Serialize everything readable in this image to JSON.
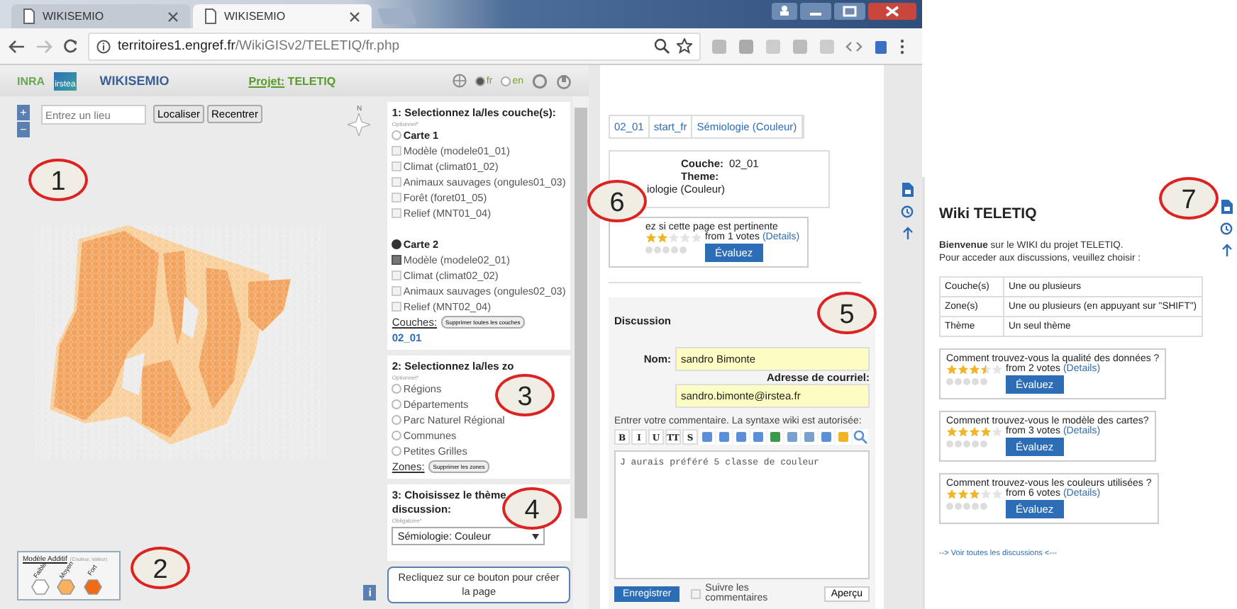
{
  "browser": {
    "tabs": [
      {
        "title": "WIKISEMIO",
        "selected": false
      },
      {
        "title": "WIKISEMIO",
        "selected": true
      }
    ],
    "url_host": "territoires1.engref.fr",
    "url_path": "/WikiGISv2/TELETIQ/fr.php"
  },
  "header": {
    "logo_inra": "INRA",
    "logo_irstea": "irstea",
    "app_name": "WIKISEMIO",
    "project_label": "Projet:",
    "project_name": "TELETIQ",
    "languages": [
      {
        "code": "fr",
        "selected": true
      },
      {
        "code": "en",
        "selected": false
      }
    ]
  },
  "map": {
    "zoom_in": "+",
    "zoom_out": "−",
    "search_placeholder": "Entrez un lieu",
    "buttons": [
      "Localiser",
      "Recentrer"
    ],
    "compass": "N",
    "legend": {
      "title": "Modèle Additif",
      "subtitle": "(Couleur, Valeur)",
      "classes": [
        {
          "label": "Faible",
          "color": "#ffffff"
        },
        {
          "label": "Moyen",
          "color": "#f9b15c"
        },
        {
          "label": "Fort",
          "color": "#f46a14"
        }
      ]
    },
    "info": "i"
  },
  "layers_panel": {
    "title": "1: Selectionnez la/les couche(s):",
    "hint": "Optionnel*",
    "maps": [
      {
        "label": "Carte 1",
        "selected": false,
        "layers": [
          {
            "label": "Modèle (modele01_01)",
            "checked": false
          },
          {
            "label": "Climat (climat01_02)",
            "checked": false
          },
          {
            "label": "Animaux sauvages (ongules01_03)",
            "checked": false
          },
          {
            "label": "Forêt (foret01_05)",
            "checked": false
          },
          {
            "label": "Relief (MNT01_04)",
            "checked": false
          }
        ]
      },
      {
        "label": "Carte 2",
        "selected": true,
        "layers": [
          {
            "label": "Modèle (modele02_01)",
            "checked": true
          },
          {
            "label": "Climat (climat02_02)",
            "checked": false
          },
          {
            "label": "Animaux sauvages (ongules02_03)",
            "checked": false
          },
          {
            "label": "Relief (MNT02_04)",
            "checked": false
          }
        ]
      }
    ],
    "couches_label": "Couches:",
    "clear_button": "Supprimer toutes les couches",
    "current": "02_01"
  },
  "zones_panel": {
    "title": "2: Selectionnez la/les zo",
    "hint": "Optionnel*",
    "zones": [
      {
        "label": "Régions",
        "selected": false
      },
      {
        "label": "Départements",
        "selected": false
      },
      {
        "label": "Parc Naturel Régional",
        "selected": false
      },
      {
        "label": "Communes",
        "selected": false
      },
      {
        "label": "Petites Grilles",
        "selected": false
      }
    ],
    "zones_label": "Zones:",
    "clear_button": "Supprimer les zones"
  },
  "theme_panel": {
    "title": "3: Choisissez le thème",
    "title_2": "discussion:",
    "hint": "Obligatoire*",
    "select_value": "Sémiologie: Couleur"
  },
  "create_button": "Recliquez sur ce bouton pour créer la page",
  "page": {
    "breadcrumbs": [
      "02_01",
      "start_fr",
      "Sémiologie (Couleur)"
    ],
    "info": {
      "couche_label": "Couche:",
      "couche_value": "02_01",
      "theme_label": "Theme:",
      "theme_value": "iologie (Couleur)"
    },
    "rating": {
      "question": "ez si cette page est pertinente",
      "stars": 2,
      "votes": "from 1 votes",
      "details": "(Details)",
      "button": "Évaluez"
    },
    "discussion": {
      "title": "Discussion",
      "name_label": "Nom:",
      "name_value": "sandro Bimonte",
      "email_label": "Adresse de courriel:",
      "email_value": "sandro.bimonte@irstea.fr",
      "comment_label": "Entrer votre commentaire. La syntaxe wiki est autorisée:",
      "format_buttons": [
        "B",
        "I",
        "U",
        "TT",
        "S"
      ],
      "comment": "J aurais préféré 5 classe de couleur",
      "save_button": "Enregistrer",
      "follow_label": "Suivre les commentaires",
      "follow_checked": false,
      "preview_button": "Aperçu"
    }
  },
  "wiki": {
    "title": "Wiki TELETIQ",
    "intro_1": "**Bienvenue** sur le WIKI du projet TELETIQ.",
    "intro_2": "Pour acceder aux discussions, veuillez choisir :",
    "table": [
      {
        "name": "Couche(s)",
        "value": "Une ou plusieurs"
      },
      {
        "name": "Zone(s)",
        "value": "Une ou plusieurs (en appuyant sur \"SHIFT\")"
      },
      {
        "name": "Thème",
        "value": "Un seul thème"
      }
    ],
    "ratings": [
      {
        "question": "Comment trouvez-vous la qualité des données ?",
        "stars": 3.5,
        "votes": "from 2 votes",
        "details": "(Details)",
        "button": "Évaluez"
      },
      {
        "question": "Comment trouvez-vous le modèle des cartes?",
        "stars": 4,
        "votes": "from 3 votes",
        "details": "(Details)",
        "button": "Évaluez"
      },
      {
        "question": "Comment trouvez-vous les couleurs utilisées ?",
        "stars": 3,
        "votes": "from 6 votes",
        "details": "(Details)",
        "button": "Évaluez"
      }
    ],
    "all_link": "--> Voir toutes les discussions <---"
  },
  "annotations": [
    "1",
    "2",
    "3",
    "4",
    "5",
    "6",
    "7"
  ]
}
